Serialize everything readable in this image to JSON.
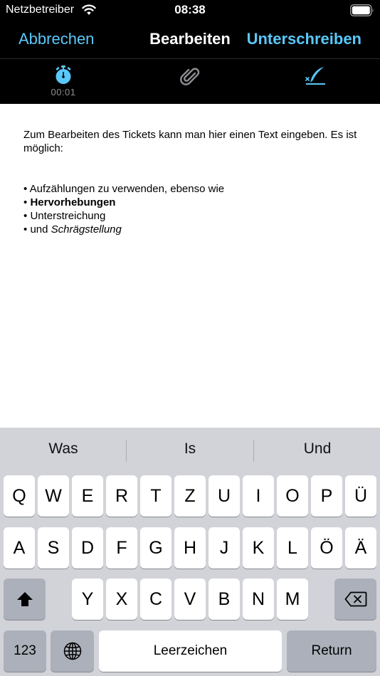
{
  "status_bar": {
    "carrier": "Netzbetreiber",
    "time": "08:38"
  },
  "nav": {
    "cancel": "Abbrechen",
    "title": "Bearbeiten",
    "sign": "Unterschreiben"
  },
  "toolbar": {
    "timer_icon": "stopwatch-icon",
    "timer": "00:01",
    "attachment_icon": "paperclip-icon",
    "signature_icon": "signature-pen-icon",
    "accent_color": "#5ac8fa"
  },
  "editor": {
    "intro": "Zum Bearbeiten des Tickets kann man hier einen Text eingeben. Es ist möglich:",
    "bullet": "•",
    "line1": "Aufzählungen zu verwenden, ebenso wie",
    "line2": "Hervorhebungen",
    "line3": "Unterstreichung",
    "line4_plain": "und",
    "line4_italic": "Schrägstellung"
  },
  "keyboard": {
    "predictions": [
      "Was",
      "Is",
      "Und"
    ],
    "row1": [
      "Q",
      "W",
      "E",
      "R",
      "T",
      "Z",
      "U",
      "I",
      "O",
      "P",
      "Ü"
    ],
    "row2": [
      "A",
      "S",
      "D",
      "F",
      "G",
      "H",
      "J",
      "K",
      "L",
      "Ö",
      "Ä"
    ],
    "row3": [
      "Y",
      "X",
      "C",
      "V",
      "B",
      "N",
      "M"
    ],
    "numbers": "123",
    "space": "Leerzeichen",
    "return": "Return",
    "shift_icon": "shift-icon",
    "globe_icon": "globe-icon",
    "delete_icon": "delete-icon"
  }
}
